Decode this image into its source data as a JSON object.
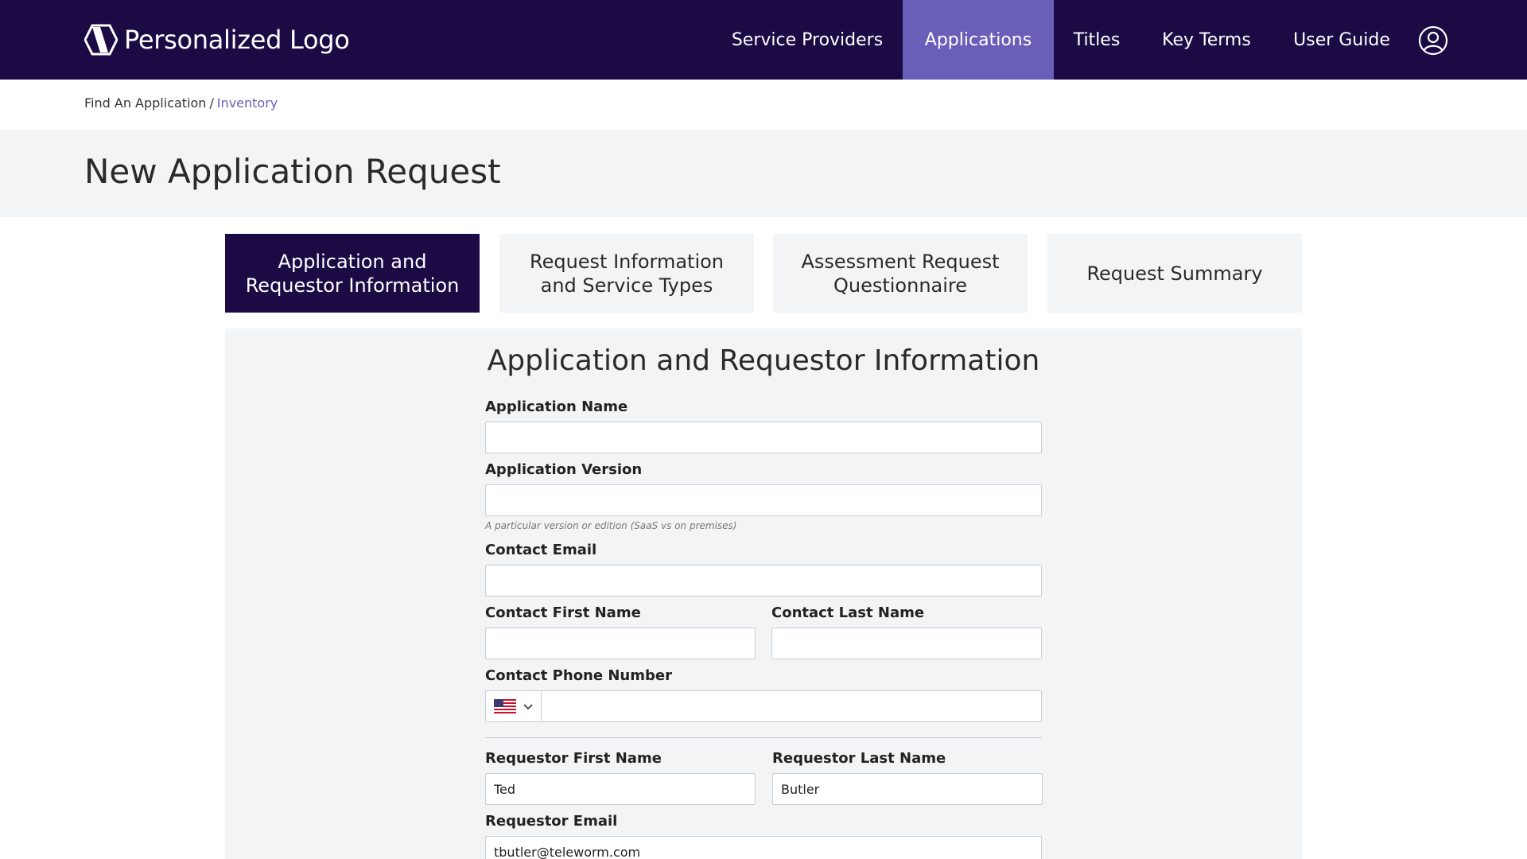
{
  "header": {
    "logo_text": "Personalized Logo",
    "nav": [
      {
        "label": "Service Providers",
        "active": false
      },
      {
        "label": "Applications",
        "active": true
      },
      {
        "label": "Titles",
        "active": false
      },
      {
        "label": "Key Terms",
        "active": false
      },
      {
        "label": "User Guide",
        "active": false
      }
    ],
    "user_icon": "user-circle-icon"
  },
  "breadcrumb": {
    "parent": "Find An Application",
    "separator": "/",
    "current": "Inventory"
  },
  "page_title": "New Application Request",
  "steps": [
    {
      "label": "Application and Requestor Information",
      "active": true
    },
    {
      "label": "Request Information and Service Types",
      "active": false
    },
    {
      "label": "Assessment Request Questionnaire",
      "active": false
    },
    {
      "label": "Request Summary",
      "active": false
    }
  ],
  "form": {
    "title": "Application and Requestor Information",
    "application_name": {
      "label": "Application Name",
      "value": ""
    },
    "application_version": {
      "label": "Application Version",
      "value": "",
      "hint": "A particular version or edition (SaaS vs on premises)"
    },
    "contact_email": {
      "label": "Contact Email",
      "value": ""
    },
    "contact_first_name": {
      "label": "Contact First Name",
      "value": ""
    },
    "contact_last_name": {
      "label": "Contact Last Name",
      "value": ""
    },
    "contact_phone": {
      "label": "Contact Phone Number",
      "country": "us-flag-icon",
      "value": ""
    },
    "requestor_first_name": {
      "label": "Requestor First Name",
      "value": "Ted"
    },
    "requestor_last_name": {
      "label": "Requestor Last Name",
      "value": "Butler"
    },
    "requestor_email": {
      "label": "Requestor Email",
      "value": "tbutler@teleworm.com"
    }
  },
  "colors": {
    "header_bg": "#1c0a45",
    "accent": "#6a5fb8",
    "panel_bg": "#f3f4f6"
  }
}
